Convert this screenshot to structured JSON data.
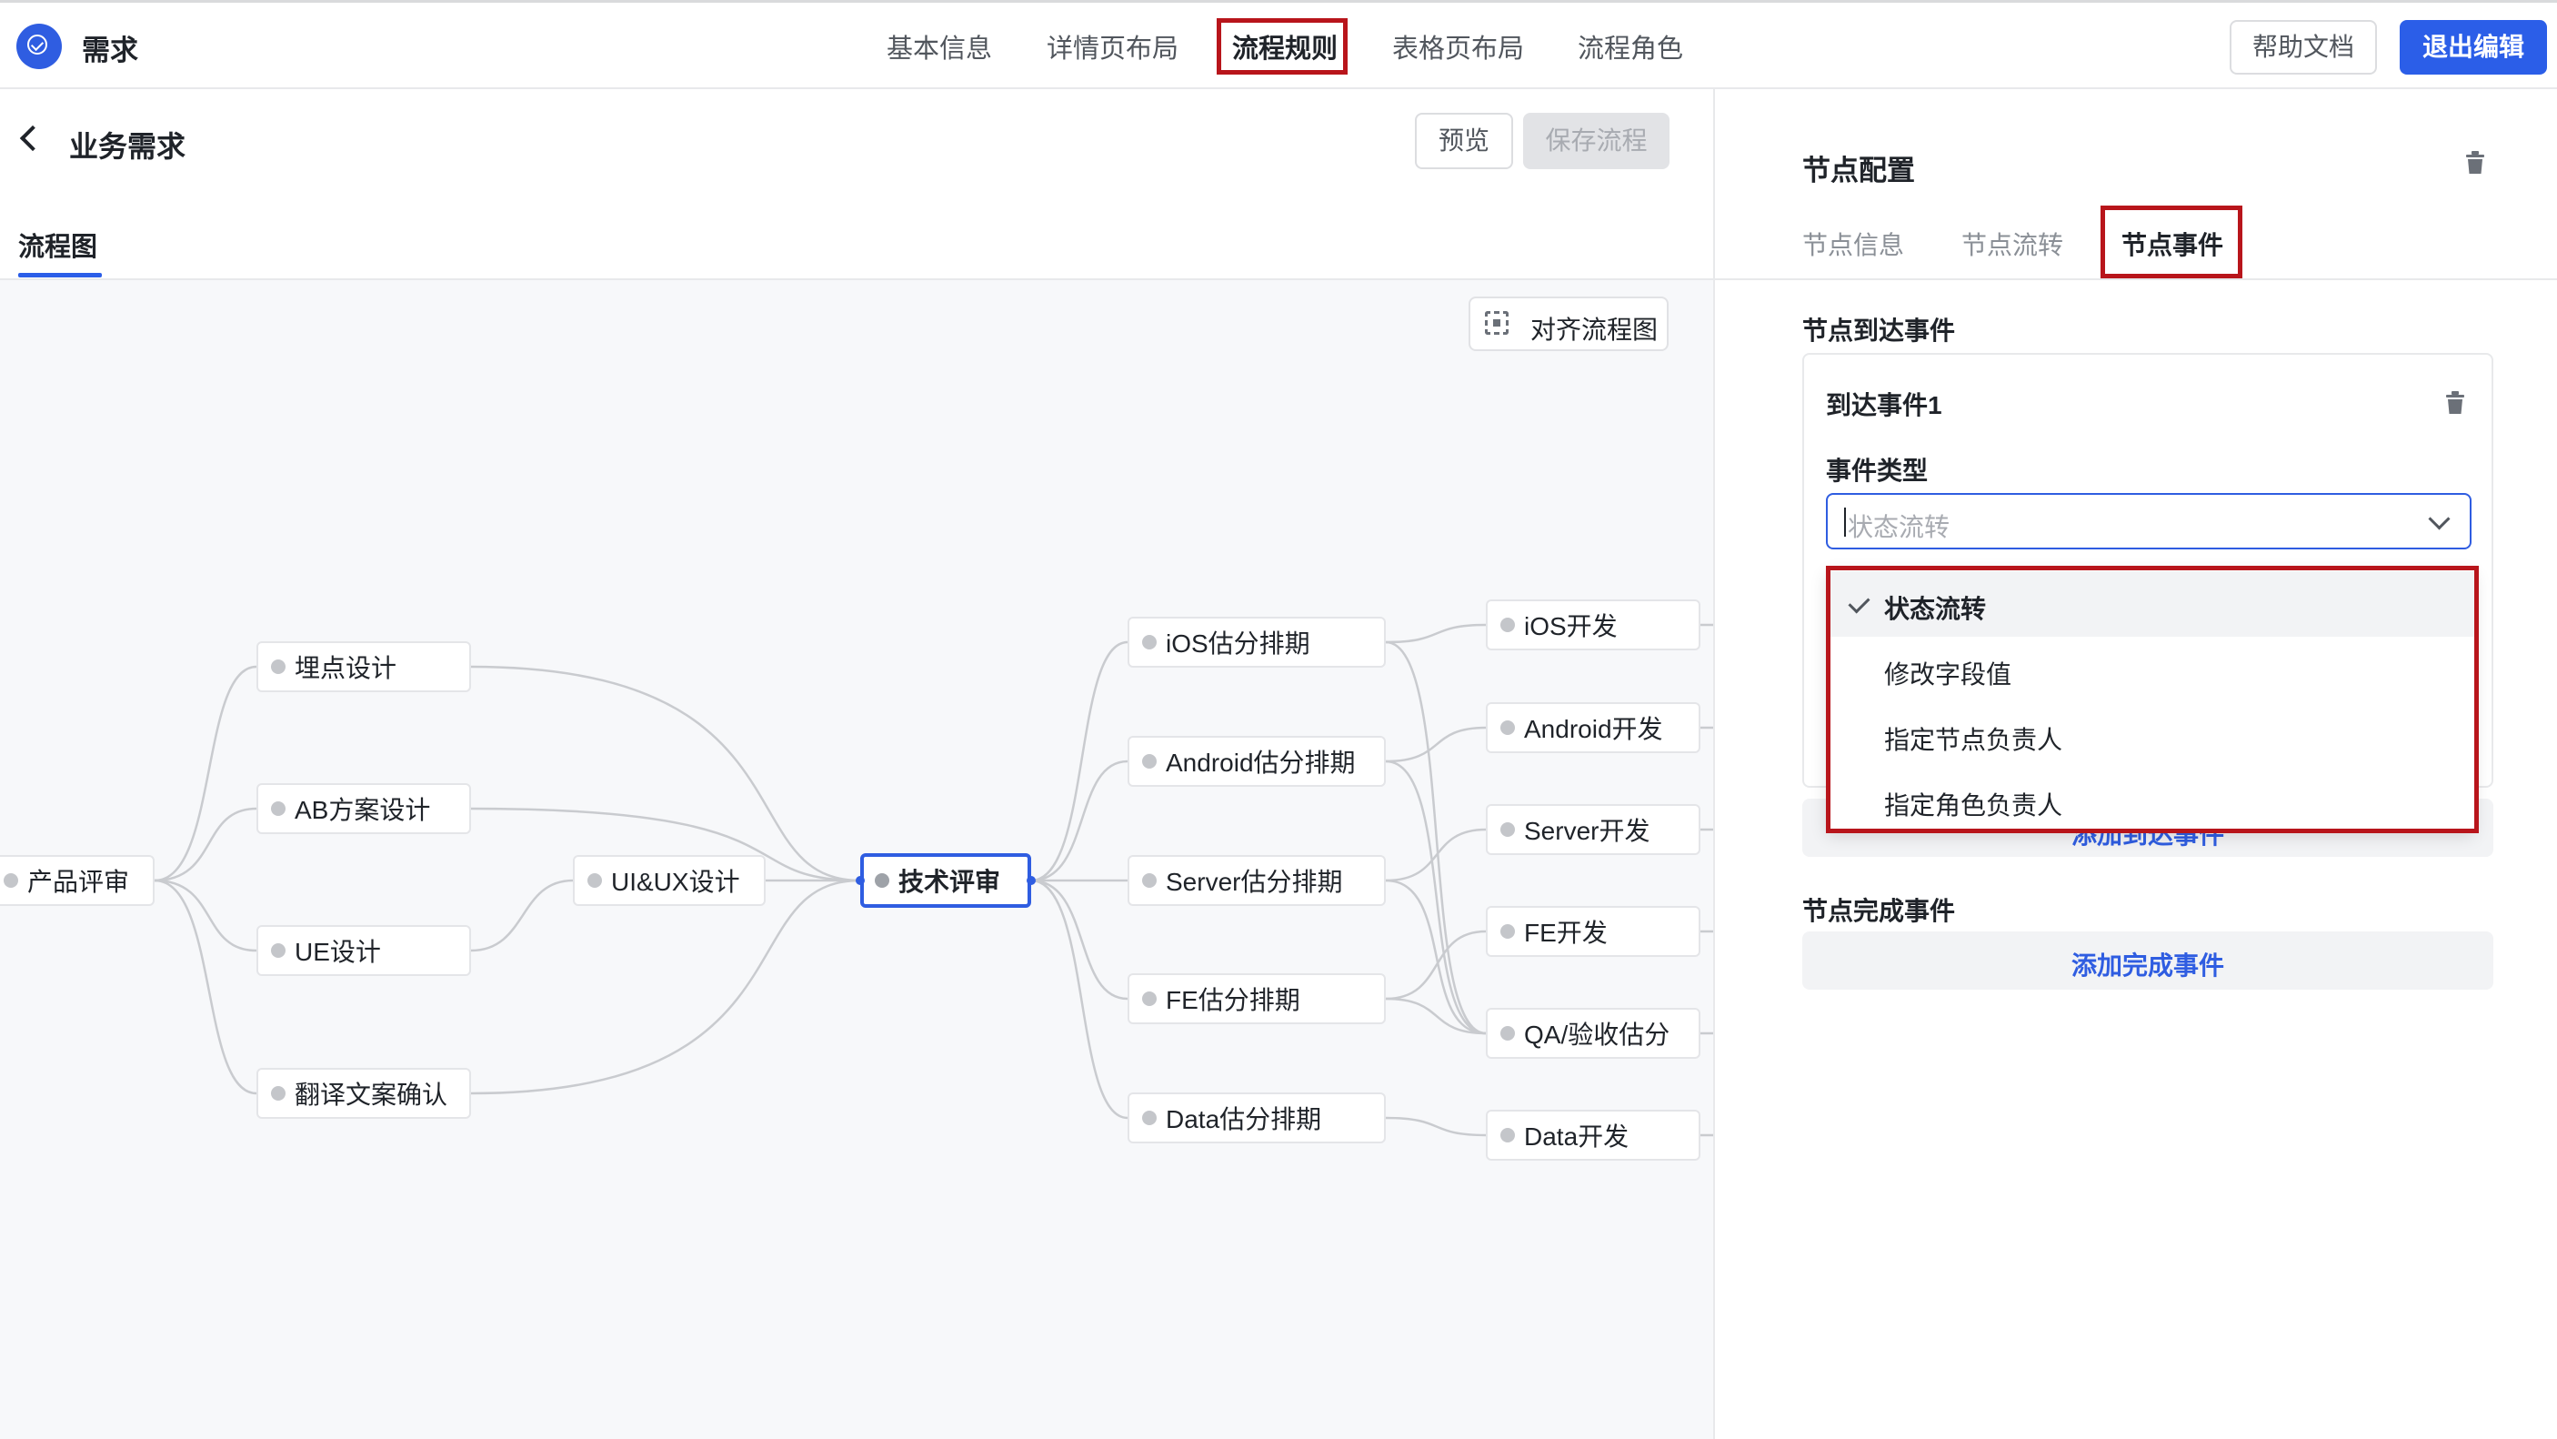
{
  "app": {
    "title": "需求",
    "nav_tabs": [
      "基本信息",
      "详情页布局",
      "流程规则",
      "表格页布局",
      "流程角色"
    ],
    "active_tab": "流程规则",
    "help_label": "帮助文档",
    "exit_label": "退出编辑"
  },
  "page": {
    "title": "业务需求",
    "preview_label": "预览",
    "save_label": "保存流程",
    "sub_tab": "流程图",
    "align_label": "对齐流程图"
  },
  "flow": {
    "nodes": [
      "产品评审",
      "埋点设计",
      "AB方案设计",
      "UE设计",
      "翻译文案确认",
      "UI&UX设计",
      "技术评审",
      "iOS估分排期",
      "Android估分排期",
      "Server估分排期",
      "FE估分排期",
      "Data估分排期",
      "iOS开发",
      "Android开发",
      "Server开发",
      "FE开发",
      "QA/验收估分",
      "Data开发"
    ],
    "active_node": "技术评审"
  },
  "panel": {
    "title": "节点配置",
    "tabs": [
      "节点信息",
      "节点流转",
      "节点事件"
    ],
    "active_tab": "节点事件",
    "arrive_section": "节点到达事件",
    "event_title": "到达事件1",
    "event_type_label": "事件类型",
    "select_placeholder": "状态流转",
    "options": [
      "状态流转",
      "修改字段值",
      "指定节点负责人",
      "指定角色负责人"
    ],
    "selected_option": "状态流转",
    "add_arrive_label": "添加到达事件",
    "complete_section": "节点完成事件",
    "add_complete_label": "添加完成事件"
  },
  "colors": {
    "accent": "#2b5ee8",
    "highlight_box": "#b8151b",
    "canvas_bg": "#f7f8fa"
  }
}
